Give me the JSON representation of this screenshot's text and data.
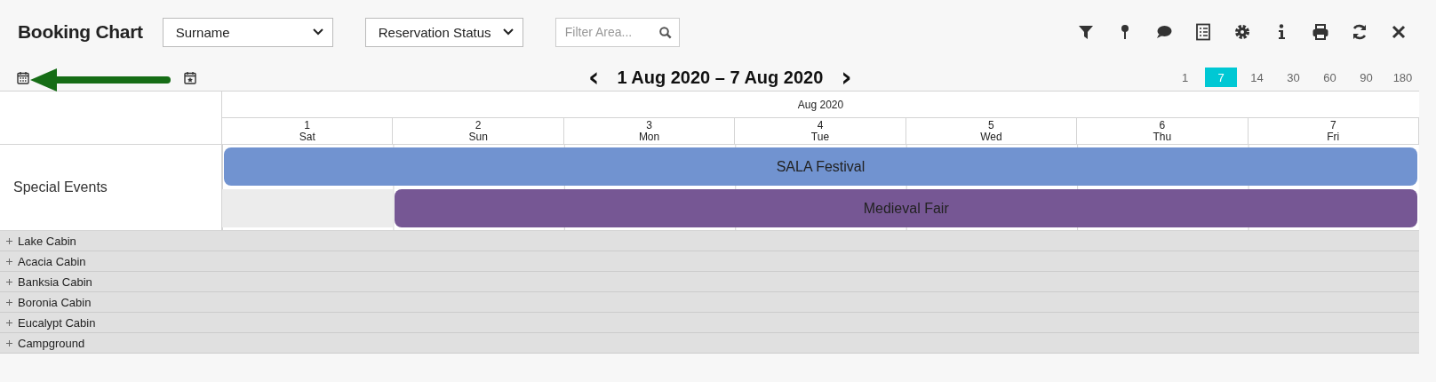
{
  "header": {
    "title": "Booking Chart",
    "selects": [
      {
        "value": "Surname"
      },
      {
        "value": "Reservation Status"
      }
    ],
    "filter": {
      "placeholder": "Filter Area..."
    }
  },
  "navigation": {
    "prev": "‹",
    "range": "1 Aug 2020 – 7 Aug 2020",
    "next": "›",
    "zoom": [
      {
        "label": "1",
        "selected": false
      },
      {
        "label": "7",
        "selected": true
      },
      {
        "label": "14",
        "selected": false
      },
      {
        "label": "30",
        "selected": false
      },
      {
        "label": "60",
        "selected": false
      },
      {
        "label": "90",
        "selected": false
      },
      {
        "label": "180",
        "selected": false
      }
    ]
  },
  "chart": {
    "month": "Aug 2020",
    "days": [
      {
        "date": "1",
        "weekday": "Sat"
      },
      {
        "date": "2",
        "weekday": "Sun"
      },
      {
        "date": "3",
        "weekday": "Mon"
      },
      {
        "date": "4",
        "weekday": "Tue"
      },
      {
        "date": "5",
        "weekday": "Wed"
      },
      {
        "date": "6",
        "weekday": "Thu"
      },
      {
        "date": "7",
        "weekday": "Fri"
      }
    ],
    "special_events": {
      "label": "Special Events",
      "events": [
        {
          "name": "SALA Festival",
          "color": "#7193d0",
          "starts_on_first_day": true
        },
        {
          "name": "Medieval Fair",
          "color": "#765794",
          "starts_on_first_day": false
        }
      ]
    },
    "resources": [
      {
        "name": "Lake Cabin",
        "expanded": false
      },
      {
        "name": "Acacia Cabin",
        "expanded": false
      },
      {
        "name": "Banksia Cabin",
        "expanded": false
      },
      {
        "name": "Boronia Cabin",
        "expanded": false
      },
      {
        "name": "Eucalypt Cabin",
        "expanded": false
      },
      {
        "name": "Campground",
        "expanded": false
      }
    ]
  }
}
